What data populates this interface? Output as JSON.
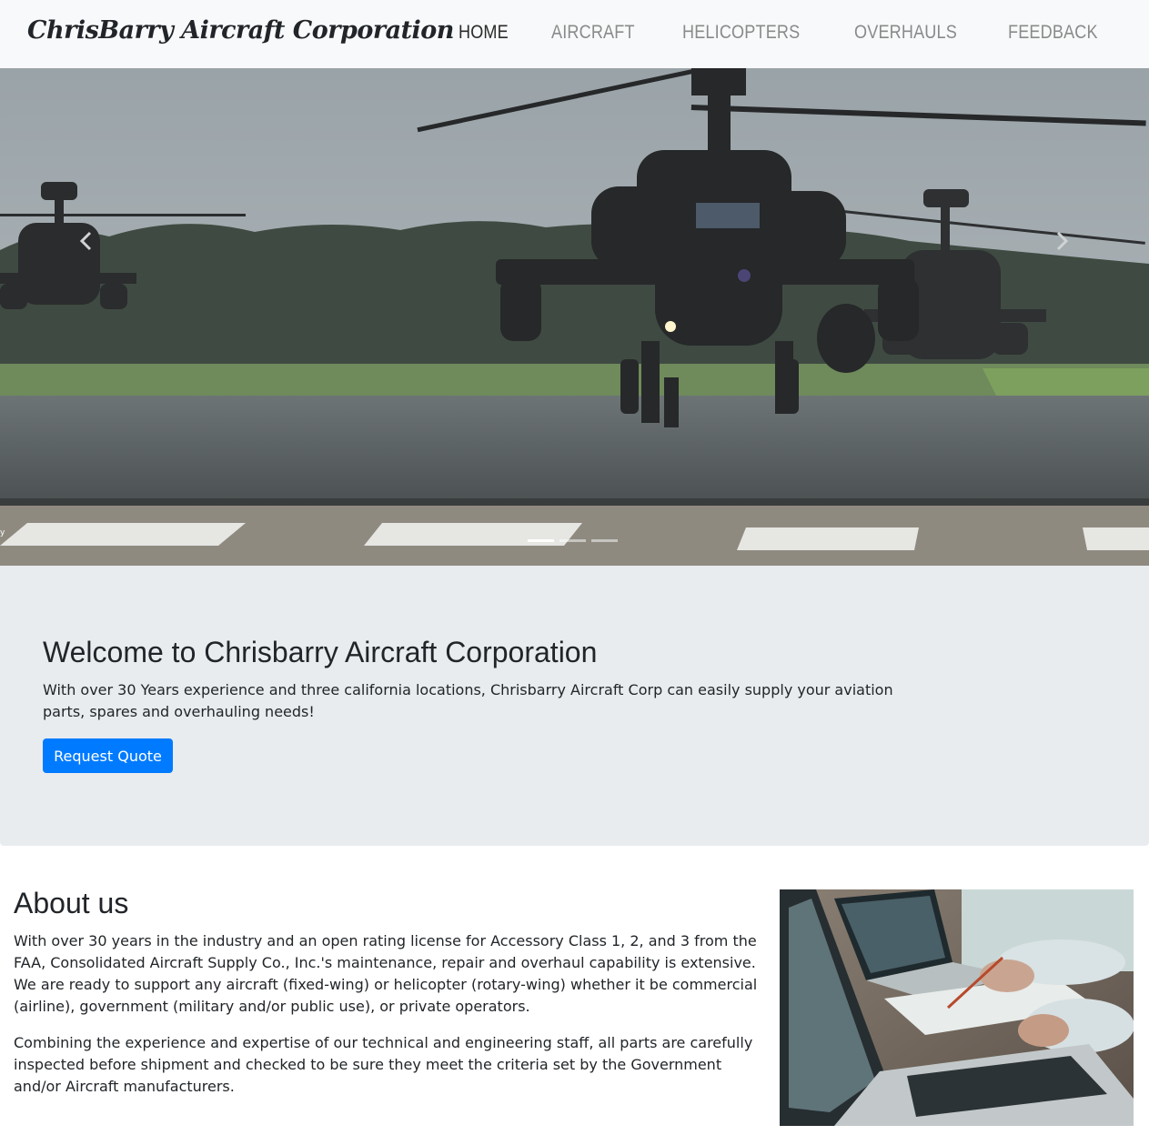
{
  "brand": "ChrisBarry Aircraft Corporation",
  "nav": [
    {
      "label": "HOME",
      "active": true
    },
    {
      "label": "AIRCRAFT",
      "active": false
    },
    {
      "label": "HELICOPTERS",
      "active": false
    },
    {
      "label": "OVERHAULS",
      "active": false
    },
    {
      "label": "FEEDBACK",
      "active": false
    }
  ],
  "carousel": {
    "slide_count": 3,
    "active_index": 0,
    "prev_icon": "chevron-left-icon",
    "next_icon": "chevron-right-icon"
  },
  "jumbotron": {
    "title": "Welcome to Chrisbarry Aircraft Corporation",
    "text": "With over 30 Years experience and three california locations, Chrisbarry Aircraft Corp can easily supply your aviation parts, spares and overhauling needs!",
    "button_label": "Request Quote"
  },
  "about": {
    "title": "About us",
    "paragraph1": "With over 30 years in the industry and an open rating license for Accessory Class 1, 2, and 3 from the FAA, Consolidated Aircraft Supply Co., Inc.'s maintenance, repair and overhaul capability is extensive. We are ready to support any aircraft (fixed-wing) or helicopter (rotary-wing) whether it be commercial (airline), government (military and/or public use), or private operators.",
    "paragraph2": "Combining the experience and expertise of our technical and engineering staff, all parts are carefully inspected before shipment and checked to be sure they meet the criteria set by the Government and/or Aircraft manufacturers."
  },
  "colors": {
    "navbar_bg": "#f8f9fa",
    "jumbotron_bg": "#e9ecef",
    "button_primary": "#007bff",
    "nav_inactive": "#8a8a8a",
    "nav_active": "#2b2b2b"
  }
}
